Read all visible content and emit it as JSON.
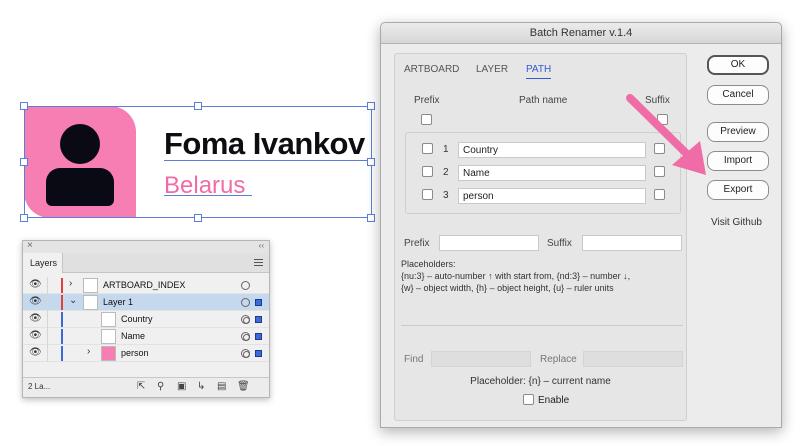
{
  "artboard": {
    "name": "Foma Ivankov",
    "country": "Belarus",
    "avatar_color": "#f77eb3",
    "country_color": "#f06ca6"
  },
  "layers_panel": {
    "tab": "Layers",
    "rows": [
      {
        "label": "ARTBOARD_INDEX",
        "color": "#e0403a",
        "selected": false
      },
      {
        "label": "Layer 1",
        "color": "#e0403a",
        "selected": true
      },
      {
        "label": "Country",
        "color": "#3d6ad6",
        "selected": false
      },
      {
        "label": "Name",
        "color": "#3d6ad6",
        "selected": false
      },
      {
        "label": "person",
        "color": "#3d6ad6",
        "selected": false
      }
    ],
    "footer_count": "2 La..."
  },
  "dialog": {
    "title": "Batch Renamer v.1.4",
    "tabs": [
      "ARTBOARD",
      "LAYER",
      "PATH"
    ],
    "active_tab": "PATH",
    "col_prefix": "Prefix",
    "col_path_name": "Path name",
    "col_suffix": "Suffix",
    "rows": [
      {
        "num": "1",
        "name": "Country"
      },
      {
        "num": "2",
        "name": "Name"
      },
      {
        "num": "3",
        "name": "person"
      }
    ],
    "prefix_label": "Prefix",
    "suffix_label": "Suffix",
    "prefix_value": "",
    "suffix_value": "",
    "placeholders_title": "Placeholders:",
    "placeholders_line1": "{nu:3} – auto-number ↑ with start from, {nd:3} – number ↓,",
    "placeholders_line2": "{w} – object width, {h} – object height, {u} – ruler units",
    "find_label": "Find",
    "replace_label": "Replace",
    "placeholder_current": "Placeholder: {n} – current name",
    "enable_label": "Enable",
    "buttons": {
      "ok": "OK",
      "cancel": "Cancel",
      "preview": "Preview",
      "import": "Import",
      "export": "Export"
    },
    "github_link": "Visit Github",
    "accent": "#2f5bd1",
    "arrow_color": "#f06ca6"
  }
}
